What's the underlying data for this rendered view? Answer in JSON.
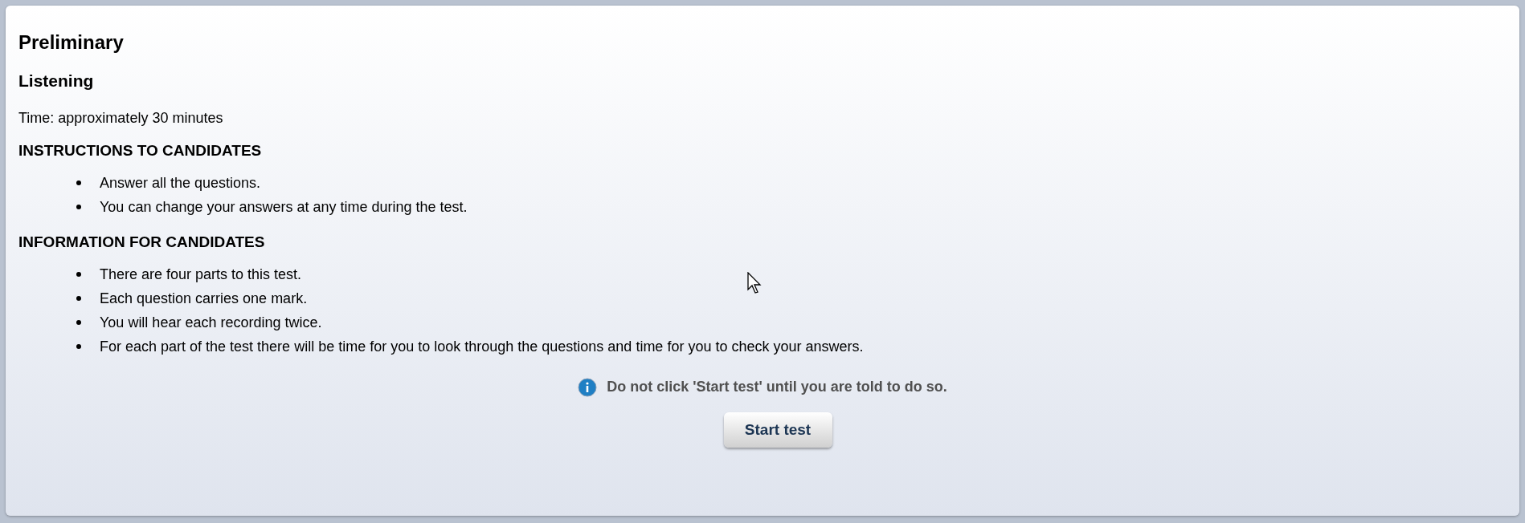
{
  "title": "Preliminary",
  "subtitle": "Listening",
  "time": "Time: approximately 30 minutes",
  "sections": [
    {
      "heading": "INSTRUCTIONS TO CANDIDATES",
      "items": [
        "Answer all the questions.",
        "You can change your answers at any time during the test."
      ]
    },
    {
      "heading": "INFORMATION FOR CANDIDATES",
      "items": [
        "There are four parts to this test.",
        "Each question carries one mark.",
        "You will hear each recording twice.",
        "For each part of the test there will be time for you to look through the questions and time for you to check your answers."
      ]
    }
  ],
  "notice": "Do not click 'Start test' until you are told to do so.",
  "button": "Start test"
}
